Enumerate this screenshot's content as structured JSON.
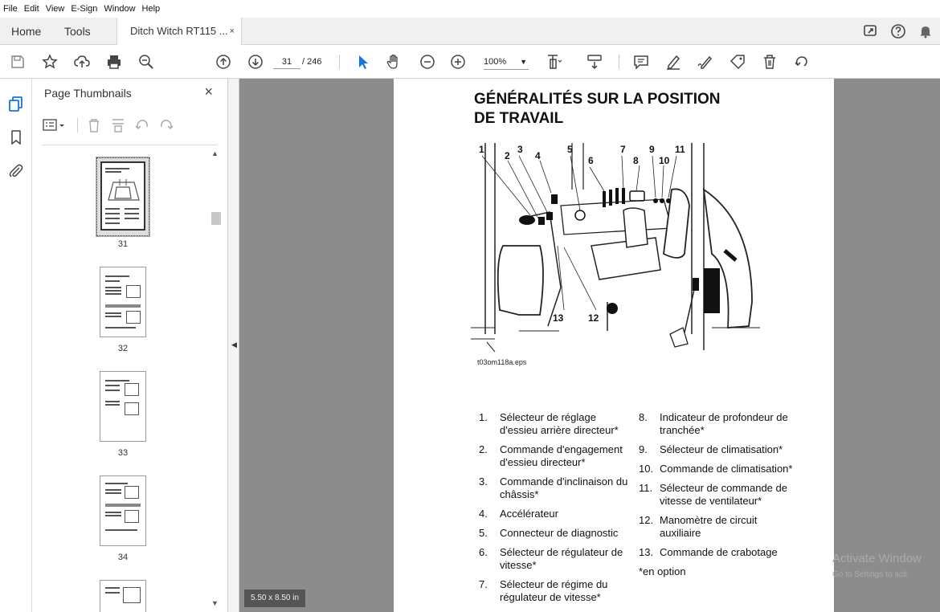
{
  "menu": [
    "File",
    "Edit",
    "View",
    "E-Sign",
    "Window",
    "Help"
  ],
  "tabs": {
    "home": "Home",
    "tools": "Tools",
    "doc": "Ditch Witch RT115 ...",
    "close": "×"
  },
  "toolbar": {
    "page_current": "31",
    "page_total": "/ 246",
    "zoom": "100%"
  },
  "thumbnails": {
    "title": "Page Thumbnails",
    "close": "×",
    "pages": [
      "31",
      "32",
      "33",
      "34"
    ]
  },
  "page": {
    "title_line1": "GÉNÉRALITÉS SUR LA POSITION",
    "title_line2": "DE TRAVAIL",
    "figure_numbers": [
      "1",
      "2",
      "3",
      "4",
      "5",
      "6",
      "7",
      "8",
      "9",
      "10",
      "11",
      "12",
      "13"
    ],
    "caption": "t03om118a.eps",
    "left_items": [
      {
        "n": "1.",
        "text": "Sélecteur de réglage d'essieu arrière directeur*"
      },
      {
        "n": "2.",
        "text": "Commande d'engagement d'essieu directeur*"
      },
      {
        "n": "3.",
        "text": "Commande d'inclinaison du châssis*"
      },
      {
        "n": "4.",
        "text": "Accélérateur"
      },
      {
        "n": "5.",
        "text": "Connecteur de diagnostic"
      },
      {
        "n": "6.",
        "text": "Sélecteur de régulateur de vitesse*"
      },
      {
        "n": "7.",
        "text": "Sélecteur de régime du régulateur de vitesse*"
      }
    ],
    "right_items": [
      {
        "n": "8.",
        "text": "Indicateur de profondeur de tranchée*"
      },
      {
        "n": "9.",
        "text": "Sélecteur de climatisation*"
      },
      {
        "n": "10.",
        "text": "Commande de climatisation*"
      },
      {
        "n": "11.",
        "text": "Sélecteur de commande de vitesse de ventilateur*"
      },
      {
        "n": "12.",
        "text": "Manomètre de circuit auxiliaire"
      },
      {
        "n": "13.",
        "text": "Commande de crabotage"
      }
    ],
    "note": "*en option"
  },
  "page_size": "5.50 x 8.50 in",
  "watermark": {
    "line1": "Activate Window",
    "line2": "Go to Settings to acti"
  }
}
